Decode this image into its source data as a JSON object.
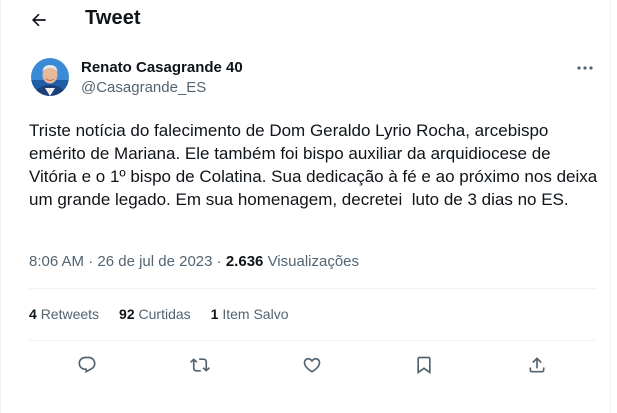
{
  "header": {
    "title": "Tweet",
    "back_icon": "arrow-left-icon"
  },
  "author": {
    "name": "Renato Casagrande 40",
    "handle": "@Casagrande_ES",
    "more_icon": "more-horizontal-icon"
  },
  "tweet": {
    "text": "Triste notícia do falecimento de Dom Geraldo Lyrio Rocha, arcebispo emérito de Mariana. Ele também foi bispo auxiliar da arquidiocese de Vitória e o 1º bispo de Colatina. Sua dedicação à fé e ao próximo nos deixa um grande legado. Em sua homenagem, decretei  luto de 3 dias no ES."
  },
  "meta": {
    "time": "8:06 AM",
    "separator": "·",
    "date": "26 de jul de 2023",
    "views_count": "2.636",
    "views_label": "Visualizações"
  },
  "stats": [
    {
      "count": "4",
      "label": "Retweets"
    },
    {
      "count": "92",
      "label": "Curtidas"
    },
    {
      "count": "1",
      "label": "Item Salvo"
    }
  ],
  "actions": [
    {
      "icon": "reply-icon"
    },
    {
      "icon": "retweet-icon"
    },
    {
      "icon": "like-icon"
    },
    {
      "icon": "bookmark-icon"
    },
    {
      "icon": "share-icon"
    }
  ],
  "colors": {
    "text": "#0f1419",
    "secondary": "#536471",
    "divider": "#eff3f4",
    "avatar_bg": "#1a73c9"
  }
}
